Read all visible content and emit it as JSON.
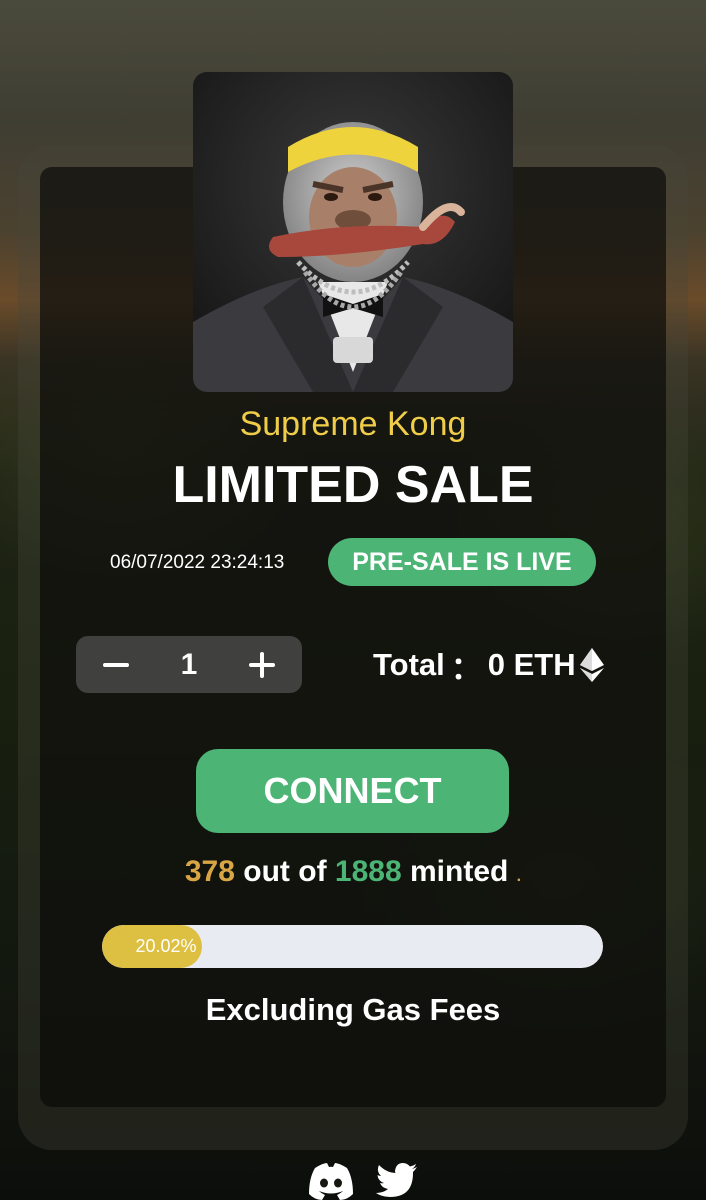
{
  "collection": {
    "name": "Supreme Kong",
    "headline": "LIMITED SALE"
  },
  "sale": {
    "datetime": "06/07/2022 23:24:13",
    "status": "PRE-SALE IS LIVE"
  },
  "quantity": {
    "decrement_symbol": "−",
    "value": "1",
    "increment_symbol": "+"
  },
  "total": {
    "label": "Total",
    "separator": "：",
    "amount": "0 ETH",
    "currency_icon": "ethereum-icon"
  },
  "connect_button": {
    "label": "CONNECT"
  },
  "mint_status": {
    "minted": "378",
    "out_of_text": " out of ",
    "total": "1888",
    "suffix_text": " minted ",
    "trailing_mark": "."
  },
  "progress": {
    "percent": 20.02,
    "label": "20.02%"
  },
  "footer": {
    "note": "Excluding Gas Fees",
    "social_icons": [
      "discord-icon",
      "twitter-icon"
    ]
  },
  "colors": {
    "accent_green": "#4cb475",
    "accent_gold": "#f0cd48",
    "minted_orange": "#d9a646",
    "progress_fill": "#ddc041",
    "progress_track": "#e9ebf2"
  }
}
